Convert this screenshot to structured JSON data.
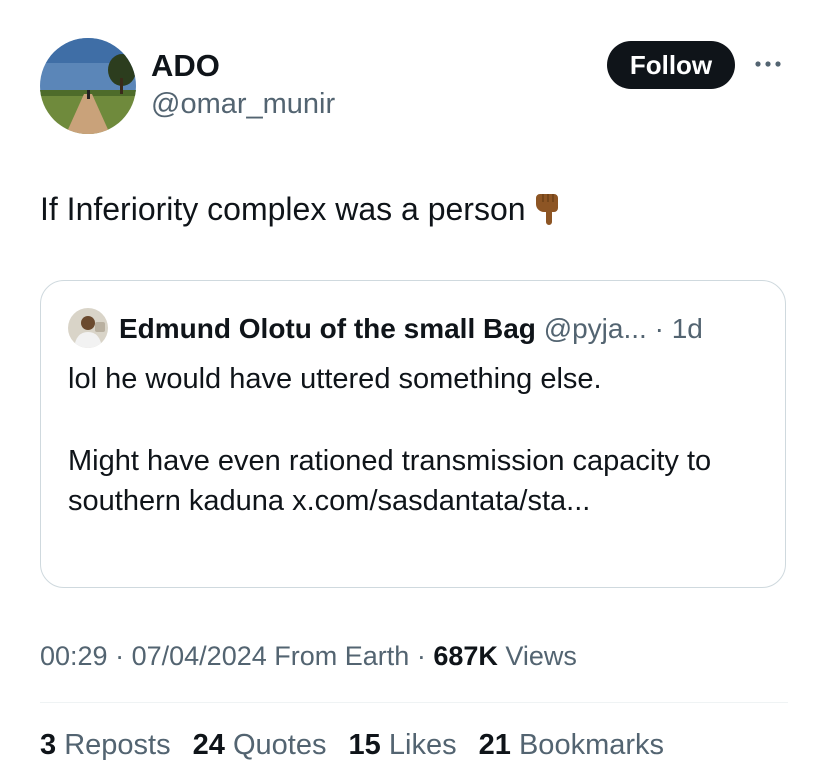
{
  "author": {
    "display_name": "ADO",
    "handle": "@omar_munir",
    "follow_label": "Follow"
  },
  "tweet": {
    "text": "If Inferiority complex was a person",
    "emoji": "backhand-index-pointing-down-emoji"
  },
  "quote": {
    "display_name": "Edmund Olotu of the small Bag",
    "handle": "@pyja...",
    "separator": "·",
    "time": "1d",
    "line1": "lol he would have uttered something else.",
    "line2": "Might have even rationed transmission capacity to southern kaduna x.com/sasdantata/sta..."
  },
  "meta": {
    "time": "00:29",
    "sep1": "·",
    "date": "07/04/2024",
    "source": "From Earth",
    "sep2": "·",
    "views_count": "687K",
    "views_label": "Views"
  },
  "stats": [
    {
      "count": "3",
      "label": "Reposts"
    },
    {
      "count": "24",
      "label": "Quotes"
    },
    {
      "count": "15",
      "label": "Likes"
    },
    {
      "count": "21",
      "label": "Bookmarks"
    }
  ],
  "colors": {
    "text": "#0f1419",
    "secondary": "#536471",
    "border": "#cfd9de",
    "button_bg": "#0f1419"
  },
  "icons": {
    "more": "more-dots-icon",
    "avatar": "landscape-path-avatar",
    "quote_avatar": "person-avatar"
  }
}
